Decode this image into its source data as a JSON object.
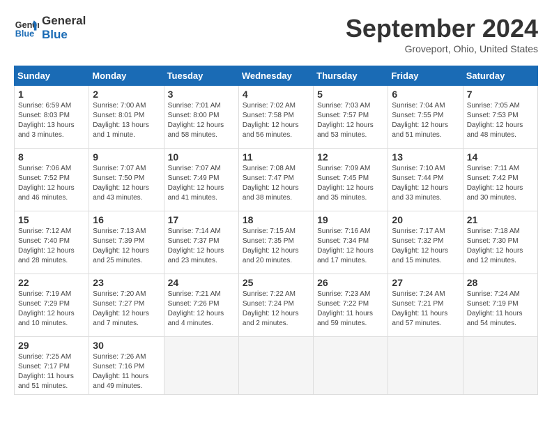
{
  "header": {
    "logo_line1": "General",
    "logo_line2": "Blue",
    "month_title": "September 2024",
    "location": "Groveport, Ohio, United States"
  },
  "weekdays": [
    "Sunday",
    "Monday",
    "Tuesday",
    "Wednesday",
    "Thursday",
    "Friday",
    "Saturday"
  ],
  "weeks": [
    [
      {
        "day": "1",
        "info": "Sunrise: 6:59 AM\nSunset: 8:03 PM\nDaylight: 13 hours\nand 3 minutes."
      },
      {
        "day": "2",
        "info": "Sunrise: 7:00 AM\nSunset: 8:01 PM\nDaylight: 13 hours\nand 1 minute."
      },
      {
        "day": "3",
        "info": "Sunrise: 7:01 AM\nSunset: 8:00 PM\nDaylight: 12 hours\nand 58 minutes."
      },
      {
        "day": "4",
        "info": "Sunrise: 7:02 AM\nSunset: 7:58 PM\nDaylight: 12 hours\nand 56 minutes."
      },
      {
        "day": "5",
        "info": "Sunrise: 7:03 AM\nSunset: 7:57 PM\nDaylight: 12 hours\nand 53 minutes."
      },
      {
        "day": "6",
        "info": "Sunrise: 7:04 AM\nSunset: 7:55 PM\nDaylight: 12 hours\nand 51 minutes."
      },
      {
        "day": "7",
        "info": "Sunrise: 7:05 AM\nSunset: 7:53 PM\nDaylight: 12 hours\nand 48 minutes."
      }
    ],
    [
      {
        "day": "8",
        "info": "Sunrise: 7:06 AM\nSunset: 7:52 PM\nDaylight: 12 hours\nand 46 minutes."
      },
      {
        "day": "9",
        "info": "Sunrise: 7:07 AM\nSunset: 7:50 PM\nDaylight: 12 hours\nand 43 minutes."
      },
      {
        "day": "10",
        "info": "Sunrise: 7:07 AM\nSunset: 7:49 PM\nDaylight: 12 hours\nand 41 minutes."
      },
      {
        "day": "11",
        "info": "Sunrise: 7:08 AM\nSunset: 7:47 PM\nDaylight: 12 hours\nand 38 minutes."
      },
      {
        "day": "12",
        "info": "Sunrise: 7:09 AM\nSunset: 7:45 PM\nDaylight: 12 hours\nand 35 minutes."
      },
      {
        "day": "13",
        "info": "Sunrise: 7:10 AM\nSunset: 7:44 PM\nDaylight: 12 hours\nand 33 minutes."
      },
      {
        "day": "14",
        "info": "Sunrise: 7:11 AM\nSunset: 7:42 PM\nDaylight: 12 hours\nand 30 minutes."
      }
    ],
    [
      {
        "day": "15",
        "info": "Sunrise: 7:12 AM\nSunset: 7:40 PM\nDaylight: 12 hours\nand 28 minutes."
      },
      {
        "day": "16",
        "info": "Sunrise: 7:13 AM\nSunset: 7:39 PM\nDaylight: 12 hours\nand 25 minutes."
      },
      {
        "day": "17",
        "info": "Sunrise: 7:14 AM\nSunset: 7:37 PM\nDaylight: 12 hours\nand 23 minutes."
      },
      {
        "day": "18",
        "info": "Sunrise: 7:15 AM\nSunset: 7:35 PM\nDaylight: 12 hours\nand 20 minutes."
      },
      {
        "day": "19",
        "info": "Sunrise: 7:16 AM\nSunset: 7:34 PM\nDaylight: 12 hours\nand 17 minutes."
      },
      {
        "day": "20",
        "info": "Sunrise: 7:17 AM\nSunset: 7:32 PM\nDaylight: 12 hours\nand 15 minutes."
      },
      {
        "day": "21",
        "info": "Sunrise: 7:18 AM\nSunset: 7:30 PM\nDaylight: 12 hours\nand 12 minutes."
      }
    ],
    [
      {
        "day": "22",
        "info": "Sunrise: 7:19 AM\nSunset: 7:29 PM\nDaylight: 12 hours\nand 10 minutes."
      },
      {
        "day": "23",
        "info": "Sunrise: 7:20 AM\nSunset: 7:27 PM\nDaylight: 12 hours\nand 7 minutes."
      },
      {
        "day": "24",
        "info": "Sunrise: 7:21 AM\nSunset: 7:26 PM\nDaylight: 12 hours\nand 4 minutes."
      },
      {
        "day": "25",
        "info": "Sunrise: 7:22 AM\nSunset: 7:24 PM\nDaylight: 12 hours\nand 2 minutes."
      },
      {
        "day": "26",
        "info": "Sunrise: 7:23 AM\nSunset: 7:22 PM\nDaylight: 11 hours\nand 59 minutes."
      },
      {
        "day": "27",
        "info": "Sunrise: 7:24 AM\nSunset: 7:21 PM\nDaylight: 11 hours\nand 57 minutes."
      },
      {
        "day": "28",
        "info": "Sunrise: 7:24 AM\nSunset: 7:19 PM\nDaylight: 11 hours\nand 54 minutes."
      }
    ],
    [
      {
        "day": "29",
        "info": "Sunrise: 7:25 AM\nSunset: 7:17 PM\nDaylight: 11 hours\nand 51 minutes."
      },
      {
        "day": "30",
        "info": "Sunrise: 7:26 AM\nSunset: 7:16 PM\nDaylight: 11 hours\nand 49 minutes."
      },
      {
        "day": "",
        "info": ""
      },
      {
        "day": "",
        "info": ""
      },
      {
        "day": "",
        "info": ""
      },
      {
        "day": "",
        "info": ""
      },
      {
        "day": "",
        "info": ""
      }
    ]
  ]
}
